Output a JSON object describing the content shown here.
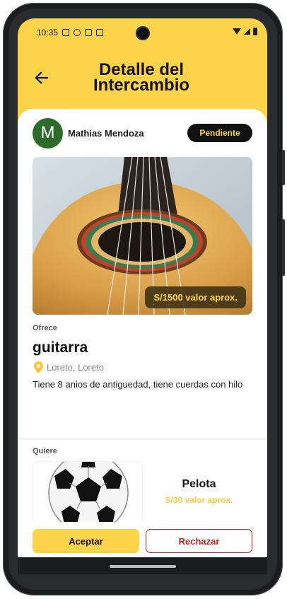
{
  "status_bar": {
    "time": "10:35"
  },
  "header": {
    "title": "Detalle del Intercambio",
    "back_icon": "arrow-left-icon"
  },
  "user": {
    "avatar_letter": "M",
    "name": "Mathias Mendoza",
    "avatar_color": "#2e6a2a"
  },
  "status_badge": {
    "label": "Pendiente"
  },
  "offer": {
    "image_alt": "guitarra",
    "price_label": "S/1500 valor aprox.",
    "section_label": "Ofrece",
    "title": "guitarra",
    "location": "Loreto, Loreto",
    "description": "Tiene 8 anios de antiguedad, tiene cuerdas con hilo"
  },
  "want": {
    "section_label": "Quiere",
    "title": "Pelota",
    "price_label": "S/30 valor aprox."
  },
  "actions": {
    "accept_label": "Aceptar",
    "reject_label": "Rechazar"
  },
  "colors": {
    "accent": "#fdd349",
    "reject": "#d71d1d",
    "badge_bg": "#111111"
  }
}
